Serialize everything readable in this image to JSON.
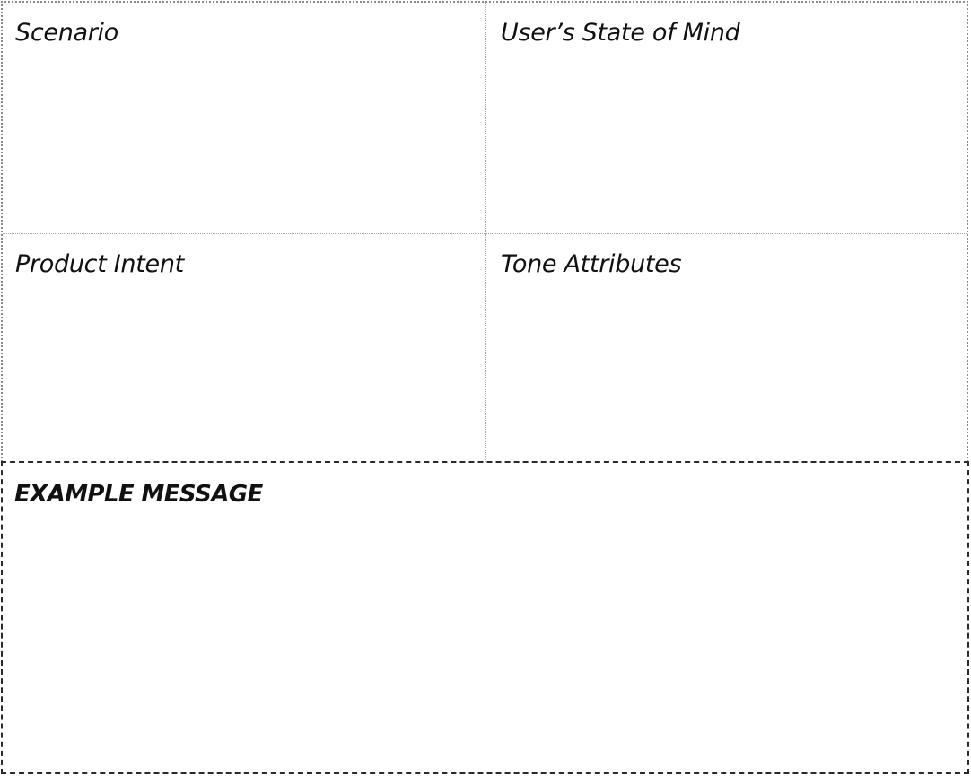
{
  "worksheet": {
    "fields": {
      "scenario": "Scenario",
      "users_state_of_mind": "User’s State of Mind",
      "product_intent": "Product Intent",
      "tone_attributes": "Tone Attributes"
    },
    "example_message": "EXAMPLE MESSAGE"
  }
}
